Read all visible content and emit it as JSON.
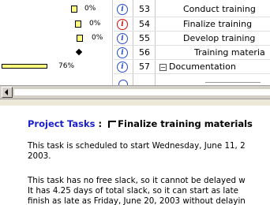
{
  "rows": [
    {
      "pct": "0%",
      "info_red": false,
      "id": "53",
      "task": "Conduct training"
    },
    {
      "pct": "0%",
      "info_red": true,
      "id": "54",
      "task": "Finalize training"
    },
    {
      "pct": "0%",
      "info_red": false,
      "id": "55",
      "task": "Develop training"
    },
    {
      "pct": "",
      "info_red": false,
      "id": "56",
      "task": "Training materia"
    },
    {
      "pct": "76%",
      "info_red": false,
      "id": "57",
      "task": "Documentation"
    }
  ],
  "info_symbol": "i",
  "collapse_symbol": "−",
  "panel": {
    "title_prefix": "Project Tasks",
    "separator": " : ",
    "task_name": "Finalize training materials",
    "para1_line1": "This task is scheduled to start Wednesday, June 11, 2",
    "para1_line2": "2003.",
    "para2_line1": "This task has no free slack, so it cannot be delayed w",
    "para2_line2": "It has 4.25 days of total slack, so it can start as late",
    "para2_line3": "finish as late as Friday, June 20, 2003 without delayin"
  }
}
